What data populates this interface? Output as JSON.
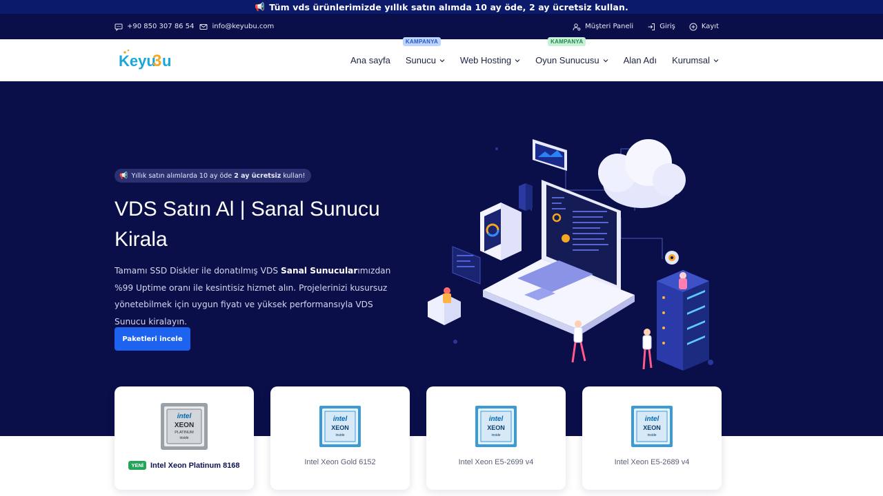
{
  "promo": {
    "text": "Tüm vds ürünlerimizde yıllık satın alımda 10 ay öde, 2 ay ücretsiz kullan."
  },
  "topbar": {
    "phone": "+90 850 307 86 54",
    "email": "info@keyubu.com",
    "customer_panel": "Müşteri Paneli",
    "login": "Giriş",
    "register": "Kayıt"
  },
  "brand": {
    "logo_text": "Keyu3u"
  },
  "nav": {
    "items": [
      {
        "label": "Ana sayfa",
        "badge": ""
      },
      {
        "label": "Sunucu",
        "badge": "KAMPANYA"
      },
      {
        "label": "Web Hosting",
        "badge": ""
      },
      {
        "label": "Oyun Sunucusu",
        "badge": "KAMPANYA"
      },
      {
        "label": "Alan Adı",
        "badge": ""
      },
      {
        "label": "Kurumsal",
        "badge": ""
      }
    ]
  },
  "hero": {
    "pill_pre": "Yıllık satın alımlarda 10 ay öde",
    "pill_bold": "2 ay ücretsiz",
    "pill_post": "kullan!",
    "title": "VDS Satın Al | Sanal Sunucu Kirala",
    "desc_pre": "Tamamı SSD Diskler ile donatılmış VDS",
    "desc_bold": "Sanal Sunucular",
    "desc_post": "ımızdan %99 Uptime oranı ile kesintisiz hizmet alın. Projelerinizi kusursuz yönetebilmek için uygun fiyatı ve yüksek performansıyla VDS Sunucu kiralayın.",
    "cta": "Paketleri incele"
  },
  "cards": [
    {
      "name": "Intel Xeon Platinum 8168",
      "badge": "YENİ",
      "chip": "platinum"
    },
    {
      "name": "Intel Xeon Gold 6152",
      "badge": "",
      "chip": "xeon"
    },
    {
      "name": "Intel Xeon E5-2699 v4",
      "badge": "",
      "chip": "xeon"
    },
    {
      "name": "Intel Xeon E5-2689 v4",
      "badge": "",
      "chip": "xeon"
    }
  ],
  "chip_text": {
    "intel": "intel",
    "xeon": "XEON",
    "platinum": "PLATINUM",
    "inside": "inside"
  },
  "colors": {
    "navy": "#0a0f4a",
    "promo": "#0b1a6b",
    "accent": "#1e63f0",
    "new": "#25a55a"
  }
}
